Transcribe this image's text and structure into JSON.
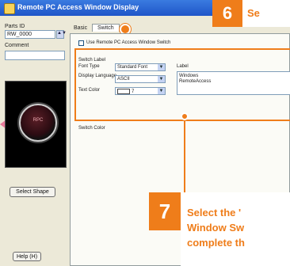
{
  "window": {
    "title": "Remote PC Access Window Display"
  },
  "left_pane": {
    "parts_id_label": "Parts ID",
    "parts_id_value": "RW_0000",
    "comment_label": "Comment",
    "comment_value": "",
    "preview_text": "RPC",
    "select_shape_label": "Select Shape",
    "help_label": "Help (H)"
  },
  "tabs": {
    "basic": "Basic",
    "switch": "Switch"
  },
  "switch_tab": {
    "use_checkbox_label": "Use Remote PC Access Window Switch",
    "use_checked": false,
    "switch_label_heading": "Switch Label",
    "font_type_label": "Font Type",
    "font_type_value": "Standard Font",
    "display_language_label": "Display Language",
    "display_language_value": "ASCII",
    "text_color_label": "Text Color",
    "text_color_value": "7",
    "label_heading": "Label",
    "label_text": "Windows\nRemoteAccess",
    "switch_color_heading": "Switch Color"
  },
  "callouts": {
    "step6_number": "6",
    "step6_text": "Se",
    "step7_number": "7",
    "step7_line1": "Select the '",
    "step7_line2": "Window Sw",
    "step7_line3": "complete th"
  },
  "colors": {
    "accent": "#ef7d1a",
    "titlebar": "#1f55c8"
  },
  "icons": {
    "window_icon": "window-icon",
    "spin": "spin-arrow-icon",
    "dropdown": "chevron-down-icon"
  }
}
